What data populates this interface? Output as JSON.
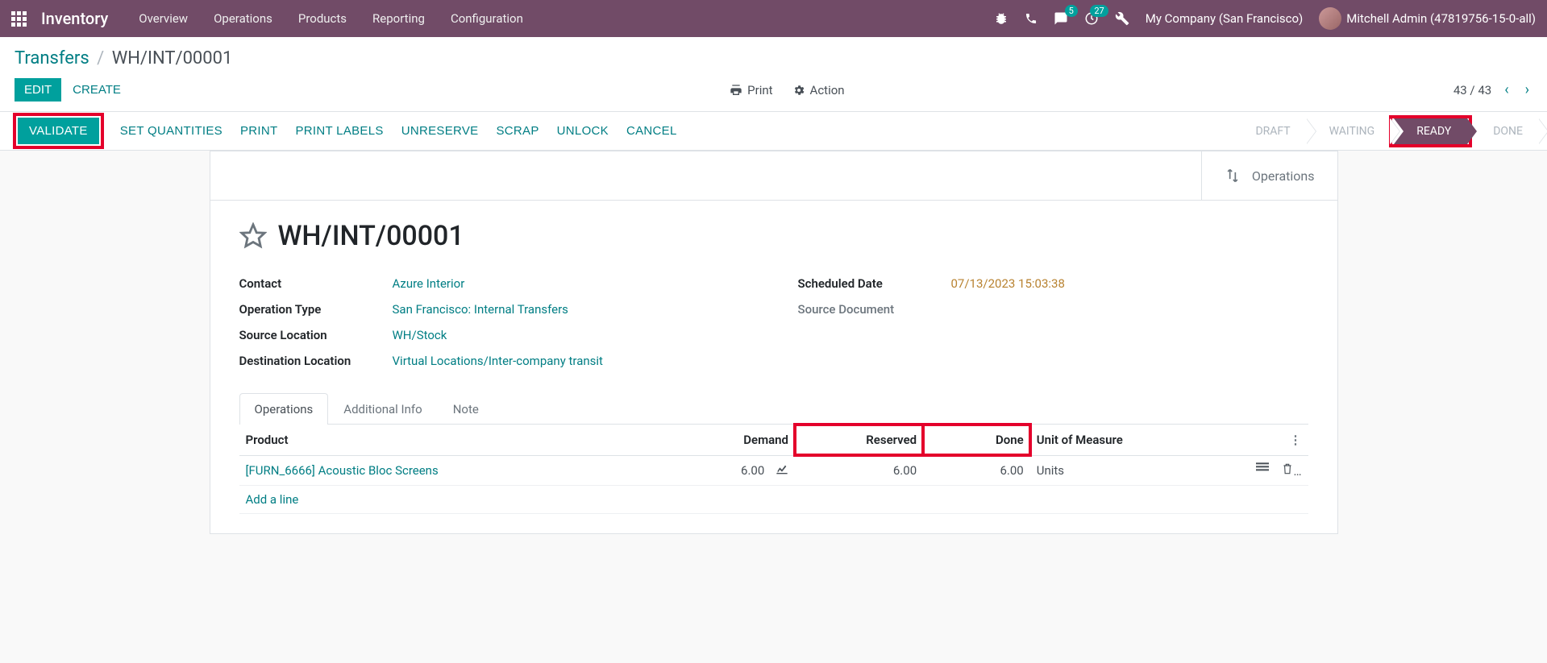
{
  "topbar": {
    "brand": "Inventory",
    "nav": [
      "Overview",
      "Operations",
      "Products",
      "Reporting",
      "Configuration"
    ],
    "msg_badge": "5",
    "activity_badge": "27",
    "company": "My Company (San Francisco)",
    "user": "Mitchell Admin (47819756-15-0-all)"
  },
  "breadcrumb": {
    "root": "Transfers",
    "current": "WH/INT/00001"
  },
  "cp": {
    "edit": "EDIT",
    "create": "CREATE",
    "print": "Print",
    "action": "Action",
    "pager": "43 / 43"
  },
  "statusbar": {
    "validate": "VALIDATE",
    "set_qty": "SET QUANTITIES",
    "print": "PRINT",
    "print_labels": "PRINT LABELS",
    "unreserve": "UNRESERVE",
    "scrap": "SCRAP",
    "unlock": "UNLOCK",
    "cancel": "CANCEL",
    "states": {
      "draft": "DRAFT",
      "waiting": "WAITING",
      "ready": "READY",
      "done": "DONE"
    }
  },
  "stat_button": {
    "label": "Operations"
  },
  "record": {
    "title": "WH/INT/00001",
    "contact_label": "Contact",
    "contact": "Azure Interior",
    "op_type_label": "Operation Type",
    "op_type": "San Francisco: Internal Transfers",
    "src_loc_label": "Source Location",
    "src_loc": "WH/Stock",
    "dst_loc_label": "Destination Location",
    "dst_loc": "Virtual Locations/Inter-company transit",
    "sched_label": "Scheduled Date",
    "sched": "07/13/2023 15:03:38",
    "srcdoc_label": "Source Document",
    "srcdoc": ""
  },
  "tabs": {
    "ops": "Operations",
    "info": "Additional Info",
    "note": "Note"
  },
  "table": {
    "headers": {
      "product": "Product",
      "demand": "Demand",
      "reserved": "Reserved",
      "done": "Done",
      "uom": "Unit of Measure"
    },
    "rows": [
      {
        "product": "[FURN_6666] Acoustic Bloc Screens",
        "demand": "6.00",
        "reserved": "6.00",
        "done": "6.00",
        "uom": "Units"
      }
    ],
    "add_line": "Add a line"
  }
}
